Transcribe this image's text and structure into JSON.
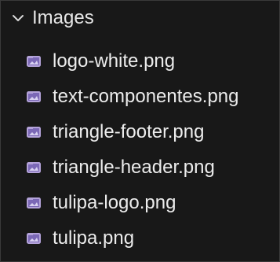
{
  "folder": {
    "label": "Images",
    "expanded": true,
    "icon": "chevron-down-icon"
  },
  "files": [
    {
      "name": "logo-white.png",
      "icon": "image-file-icon"
    },
    {
      "name": "text-componentes.png",
      "icon": "image-file-icon"
    },
    {
      "name": "triangle-footer.png",
      "icon": "image-file-icon"
    },
    {
      "name": "triangle-header.png",
      "icon": "image-file-icon"
    },
    {
      "name": "tulipa-logo.png",
      "icon": "image-file-icon"
    },
    {
      "name": "tulipa.png",
      "icon": "image-file-icon"
    }
  ],
  "colors": {
    "background": "#181818",
    "text": "#e6e6e6",
    "image_icon_frame": "#b3a2d9",
    "image_icon_fill": "#7b68b6"
  }
}
